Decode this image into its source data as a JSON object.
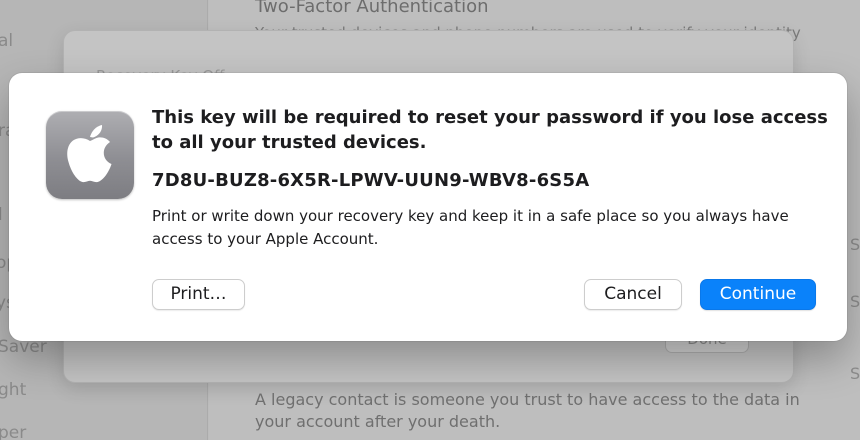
{
  "background": {
    "sidebar_fragments": [
      "al",
      "ra",
      "l",
      "op",
      "ys",
      "Saver",
      "ght",
      "per"
    ],
    "section_heading": "Two-Factor Authentication",
    "section_subtext": "Your trusted devices and phone numbers are used to verify your identity",
    "sheet_text": "Recovery Key Off",
    "done_label": "Done",
    "legacy_text": "A legacy contact is someone you trust to have access to the data in your account after your death.",
    "right_fragments": [
      "S",
      "S",
      "S"
    ]
  },
  "dialog": {
    "icon": "apple-logo-icon",
    "title": "This key will be required to reset your password if you lose access to all your trusted devices.",
    "recovery_key": "7D8U-BUZ8-6X5R-LPWV-UUN9-WBV8-6S5A",
    "message": "Print or write down your recovery key and keep it in a safe place so you always have access to your Apple Account.",
    "buttons": {
      "print": "Print…",
      "cancel": "Cancel",
      "continue": "Continue"
    }
  },
  "colors": {
    "accent": "#0a82fa",
    "text": "#1d1d1f",
    "dialog_bg": "#ffffff"
  }
}
